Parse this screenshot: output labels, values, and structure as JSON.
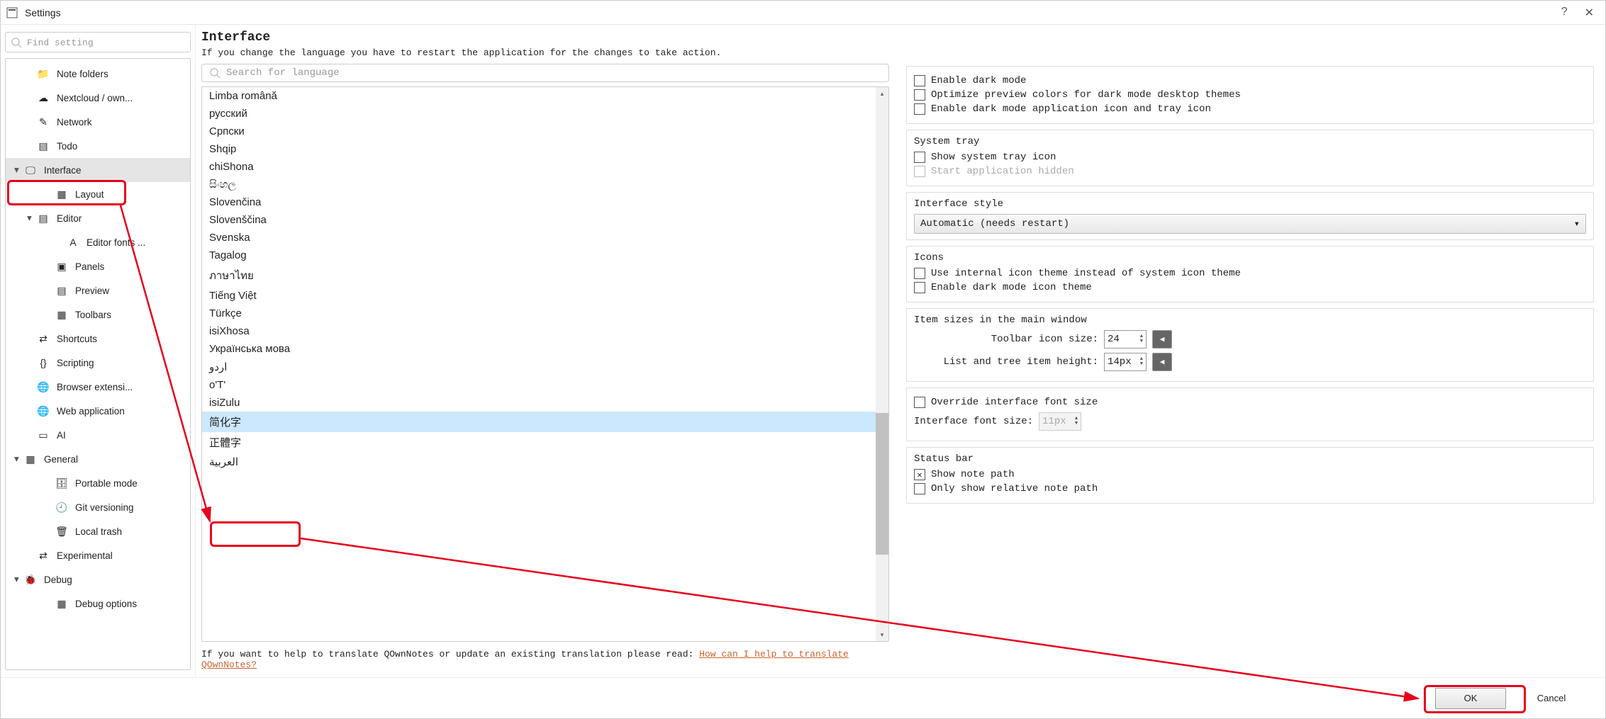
{
  "window": {
    "title": "Settings"
  },
  "titlebar": {
    "help": "?",
    "close": "✕"
  },
  "sidebar": {
    "search_ph": "Find setting",
    "items": [
      {
        "label": "Note folders",
        "depth": 1,
        "icon": "folder"
      },
      {
        "label": "Nextcloud / own...",
        "depth": 1,
        "icon": "cloud"
      },
      {
        "label": "Network",
        "depth": 1,
        "icon": "net"
      },
      {
        "label": "Todo",
        "depth": 1,
        "icon": "todo"
      },
      {
        "label": "Interface",
        "depth": 0,
        "icon": "monitor",
        "arrow": "▾",
        "sel": true
      },
      {
        "label": "Layout",
        "depth": 2,
        "icon": "layout"
      },
      {
        "label": "Editor",
        "depth": 1,
        "icon": "editor",
        "arrow": "▾"
      },
      {
        "label": "Editor fonts ...",
        "depth": 3,
        "icon": "font"
      },
      {
        "label": "Panels",
        "depth": 2,
        "icon": "panels"
      },
      {
        "label": "Preview",
        "depth": 2,
        "icon": "preview"
      },
      {
        "label": "Toolbars",
        "depth": 2,
        "icon": "toolbars"
      },
      {
        "label": "Shortcuts",
        "depth": 1,
        "icon": "shortcut"
      },
      {
        "label": "Scripting",
        "depth": 1,
        "icon": "script"
      },
      {
        "label": "Browser extensi...",
        "depth": 1,
        "icon": "globe"
      },
      {
        "label": "Web application",
        "depth": 1,
        "icon": "globe"
      },
      {
        "label": "AI",
        "depth": 1,
        "icon": "ai"
      },
      {
        "label": "General",
        "depth": 0,
        "icon": "general",
        "arrow": "▾"
      },
      {
        "label": "Portable mode",
        "depth": 2,
        "icon": "portable"
      },
      {
        "label": "Git versioning",
        "depth": 2,
        "icon": "git"
      },
      {
        "label": "Local trash",
        "depth": 2,
        "icon": "trash"
      },
      {
        "label": "Experimental",
        "depth": 1,
        "icon": "exp"
      },
      {
        "label": "Debug",
        "depth": 0,
        "icon": "bug",
        "arrow": "▾"
      },
      {
        "label": "Debug options",
        "depth": 2,
        "icon": "debugopt"
      }
    ]
  },
  "main": {
    "heading": "Interface",
    "subtext": "If you change the language you have to restart the application for the changes to take action.",
    "lang_search_ph": "Search for language",
    "help_prefix": "If you want to help to translate QOwnNotes or update an existing translation please read: ",
    "help_link": "How can I help to translate QOwnNotes?"
  },
  "languages": [
    "Limba română",
    "русский",
    "Српски",
    "Shqip",
    "chiShona",
    "සිංහල",
    "Slovenčina",
    "Slovenščina",
    "Svenska",
    "Tagalog",
    "ภาษาไทย",
    "Tiếng Việt",
    "Türkçe",
    "isiXhosa",
    "Українська мова",
    "اردو",
    "o'T'",
    "isiZulu",
    "简化字",
    "正體字",
    "العربية"
  ],
  "lang_selected_index": 18,
  "right": {
    "dark": {
      "items": [
        "Enable dark mode",
        "Optimize preview colors for dark mode desktop themes",
        "Enable dark mode application icon and tray icon"
      ]
    },
    "tray": {
      "title": "System tray",
      "show": "Show system tray icon",
      "hidden": "Start application hidden"
    },
    "style": {
      "title": "Interface style",
      "value": "Automatic (needs restart)"
    },
    "icons_sec": {
      "title": "Icons",
      "internal": "Use internal icon theme instead of system icon theme",
      "darkicon": "Enable dark mode icon theme"
    },
    "sizes": {
      "title": "Item sizes in the main window",
      "toolbar_label": "Toolbar icon size:",
      "toolbar_val": "24",
      "tree_label": "List and tree item height:",
      "tree_val": "14px"
    },
    "font": {
      "override": "Override interface font size",
      "label": "Interface font size:",
      "val": "11px"
    },
    "status": {
      "title": "Status bar",
      "path": "Show note path",
      "rel": "Only show relative note path"
    }
  },
  "buttons": {
    "ok": "OK",
    "cancel": "Cancel"
  }
}
